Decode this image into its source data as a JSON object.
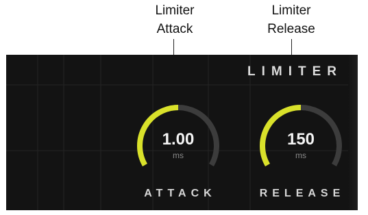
{
  "callouts": {
    "attack": {
      "line1": "Limiter",
      "line2": "Attack"
    },
    "release": {
      "line1": "Limiter",
      "line2": "Release"
    }
  },
  "section": {
    "title": "LIMITER"
  },
  "knobs": {
    "attack": {
      "value": "1.00",
      "unit": "ms",
      "label": "ATTACK",
      "level": 0.5
    },
    "release": {
      "value": "150",
      "unit": "ms",
      "label": "RELEASE",
      "level": 0.5
    }
  },
  "colors": {
    "accent": "#d9e12a",
    "track": "#3c3c3c",
    "panel": "#131313"
  }
}
